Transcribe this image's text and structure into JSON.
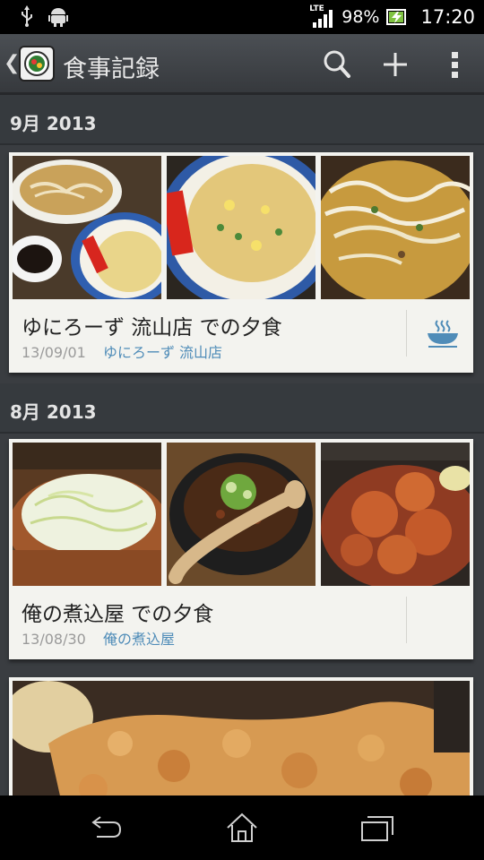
{
  "status_bar": {
    "battery": "98%",
    "time": "17:20",
    "network": "LTE",
    "icons": [
      "usb-icon",
      "android-debug-icon",
      "signal-icon",
      "battery-charging-icon"
    ]
  },
  "action_bar": {
    "title": "食事記録",
    "actions": [
      "search-icon",
      "add-icon",
      "overflow-menu-icon"
    ]
  },
  "sections": [
    {
      "header": "9月 2013",
      "entries": [
        {
          "title": "ゆにろーず 流山店 での夕食",
          "date": "13/09/01",
          "place": "ゆにろーず 流山店",
          "category_icon": "ramen-bowl-icon",
          "photos": [
            "ramen-with-fried-rice-photo",
            "fried-rice-photo",
            "bean-sprout-noodles-photo"
          ]
        }
      ]
    },
    {
      "header": "8月 2013",
      "entries": [
        {
          "title": "俺の煮込屋 での夕食",
          "date": "13/08/30",
          "place": "俺の煮込屋",
          "photos": [
            "cabbage-salad-photo",
            "stew-pot-photo",
            "fried-chicken-photo"
          ]
        },
        {
          "photos": [
            "fried-cutlet-photo"
          ]
        }
      ]
    }
  ],
  "nav_bar": {
    "buttons": [
      "back-icon",
      "home-icon",
      "recent-apps-icon"
    ]
  },
  "colors": {
    "accent_link": "#4f8cb8",
    "card_bg": "#f3f3ef",
    "background": "#3a3d41"
  }
}
